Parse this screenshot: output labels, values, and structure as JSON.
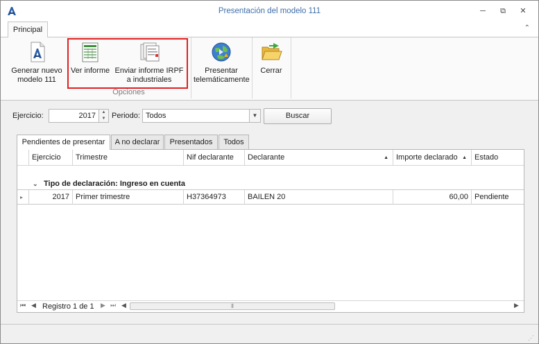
{
  "window": {
    "title": "Presentación del modelo 111",
    "controls": {
      "minimize": "─",
      "restore": "⧉",
      "close": "✕"
    }
  },
  "ribbon": {
    "tab": "Principal",
    "collapse_glyph": "⌃",
    "buttons": {
      "generar": "Generar nuevo modelo 111",
      "ver": "Ver informe",
      "enviar": "Enviar informe IRPF a industriales",
      "presentar": "Presentar telemáticamente",
      "cerrar": "Cerrar"
    },
    "group_label": "Opciones"
  },
  "filters": {
    "ejercicio_label": "Ejercicio:",
    "ejercicio_value": "2017",
    "periodo_label": "Periodo:",
    "periodo_value": "Todos",
    "buscar": "Buscar"
  },
  "grid_tabs": [
    "Pendientes de presentar",
    "A no declarar",
    "Presentados",
    "Todos"
  ],
  "grid": {
    "columns": [
      "Ejercicio",
      "Trimestre",
      "Nif declarante",
      "Declarante",
      "Importe declarado",
      "Estado"
    ],
    "group_header": "Tipo de declaración: Ingreso en cuenta",
    "rows": [
      {
        "ejercicio": "2017",
        "trimestre": "Primer trimestre",
        "nif": "H37364973",
        "declarante": "BAILEN 20",
        "importe": "60,00",
        "estado": "Pendiente"
      }
    ],
    "footer": {
      "registro": "Registro 1 de 1"
    }
  },
  "colors": {
    "highlight": "#e01f1f",
    "title": "#3f6fa8"
  }
}
